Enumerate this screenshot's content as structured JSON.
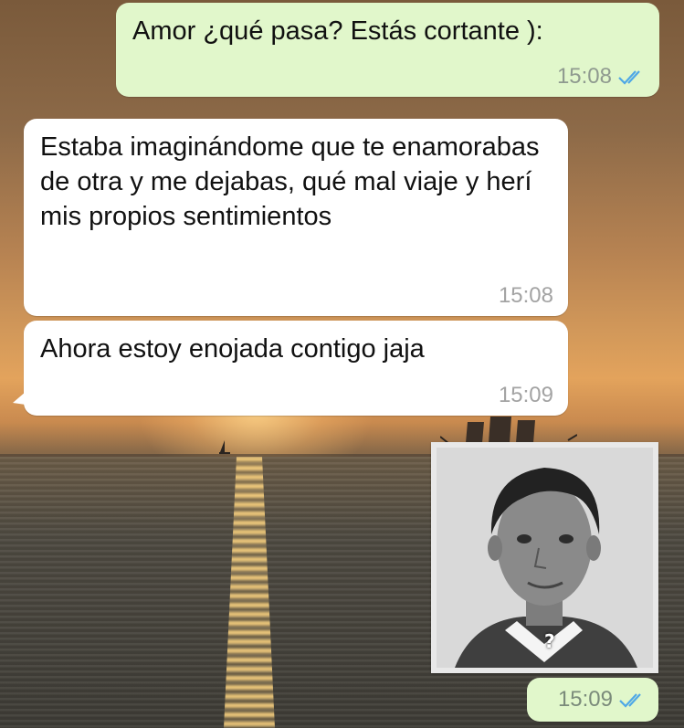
{
  "messages": [
    {
      "direction": "outgoing",
      "text": "Amor ¿qué pasa? Estás cortante ):",
      "time": "15:08",
      "status": "read"
    },
    {
      "direction": "incoming",
      "text": "Estaba imaginándome que te enamorabas de otra y me dejabas, qué mal viaje y herí mis propios sentimientos",
      "time": "15:08"
    },
    {
      "direction": "incoming",
      "text": "Ahora estoy enojada contigo jaja",
      "time": "15:09"
    },
    {
      "direction": "outgoing",
      "type": "image",
      "image_caption": "?",
      "time": "15:09",
      "status": "read"
    }
  ],
  "colors": {
    "outgoing_bubble": "#e1f7cb",
    "incoming_bubble": "#ffffff",
    "read_ticks": "#4fa8e6"
  },
  "icons": {
    "read_receipt": "double-check-icon"
  }
}
